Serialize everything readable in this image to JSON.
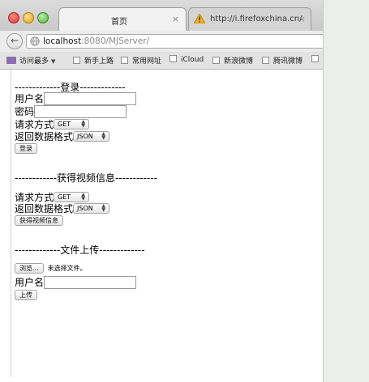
{
  "browser": {
    "tabs": [
      {
        "title": "首页",
        "close": "×",
        "active": true
      },
      {
        "title": "http://i.firefoxchina.cn/",
        "close": "×",
        "active": false
      }
    ],
    "url": {
      "host": "localhost",
      "path": ":8080/MJServer/"
    },
    "bookmarks": [
      {
        "label": "访问最多",
        "type": "folder",
        "dropdown": "▼"
      },
      {
        "label": "新手上路",
        "type": "page"
      },
      {
        "label": "常用网址",
        "type": "page"
      },
      {
        "label": "iCloud",
        "type": "page"
      },
      {
        "label": "新浪微博",
        "type": "page"
      },
      {
        "label": "腾讯微博",
        "type": "page"
      }
    ],
    "icons": {
      "back": "back-arrow-icon",
      "site": "globe-icon",
      "warning": "warning-icon"
    }
  },
  "page": {
    "login": {
      "heading": "-------------登录-------------",
      "username_label": "用户名",
      "password_label": "密码",
      "method_label": "请求方式",
      "method_value": "GET",
      "format_label": "返回数据格式",
      "format_value": "JSON",
      "submit_label": "登录"
    },
    "video": {
      "heading": "------------获得视频信息------------",
      "method_label": "请求方式",
      "method_value": "GET",
      "format_label": "返回数据格式",
      "format_value": "JSON",
      "submit_label": "获得视频信息"
    },
    "upload": {
      "heading": "-------------文件上传-------------",
      "browse_label": "浏览...",
      "no_file_text": "未选择文件。",
      "username_label": "用户名",
      "submit_label": "上传"
    }
  }
}
